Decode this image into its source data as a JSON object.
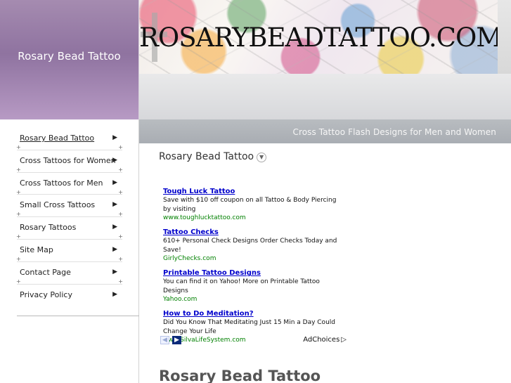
{
  "site": {
    "brand_title": "Rosary Bead Tattoo",
    "banner_text": "ROSARYBEADTATTOO.COM",
    "subtitle": "Cross Tattoo Flash Designs for Men and Women"
  },
  "sidebar": {
    "items": [
      {
        "label": "Rosary Bead Tattoo",
        "active": true,
        "arrow": "▶"
      },
      {
        "label": "Cross Tattoos for Women",
        "active": false,
        "arrow": "▶"
      },
      {
        "label": "Cross Tattoos for Men",
        "active": false,
        "arrow": "▶"
      },
      {
        "label": "Small Cross Tattoos",
        "active": false,
        "arrow": "▶"
      },
      {
        "label": "Rosary Tattoos",
        "active": false,
        "arrow": "▶"
      },
      {
        "label": "Site Map",
        "active": false,
        "arrow": "▶"
      },
      {
        "label": "Contact Page",
        "active": false,
        "arrow": "▶"
      },
      {
        "label": "Privacy Policy",
        "active": false,
        "arrow": "▶"
      }
    ],
    "separator_symbol": "+"
  },
  "main": {
    "heading": "Rosary Bead Tattoo",
    "heading_icon": "chevron-down-icon",
    "page_title": "Rosary Bead Tattoo",
    "ads": [
      {
        "title": "Tough Luck Tattoo",
        "text": "Save with $10 off coupon on all Tattoo & Body Piercing by visiting",
        "url": "www.toughlucktattoo.com"
      },
      {
        "title": "Tattoo Checks",
        "text": "610+ Personal Check Designs Order Checks Today and Save!",
        "url": "GirlyChecks.com"
      },
      {
        "title": "Printable Tattoo Designs",
        "text": "You can find it on Yahoo! More on Printable Tattoo Designs",
        "url": "Yahoo.com"
      },
      {
        "title": "How to Do Meditation?",
        "text": "Did You Know That Meditating Just 15 Min a Day Could Change Your Life",
        "url": "www.SilvaLifeSystem.com"
      }
    ],
    "ad_controls": {
      "prev_symbol": "◀",
      "next_symbol": "▶",
      "adchoices_label": "AdChoices",
      "adchoices_symbol": "▷"
    }
  },
  "colors": {
    "brand_purple": "#9f82ac",
    "subtitle_bar": "#b1b5ba",
    "ad_link": "#0000cc",
    "ad_url": "#008000"
  }
}
